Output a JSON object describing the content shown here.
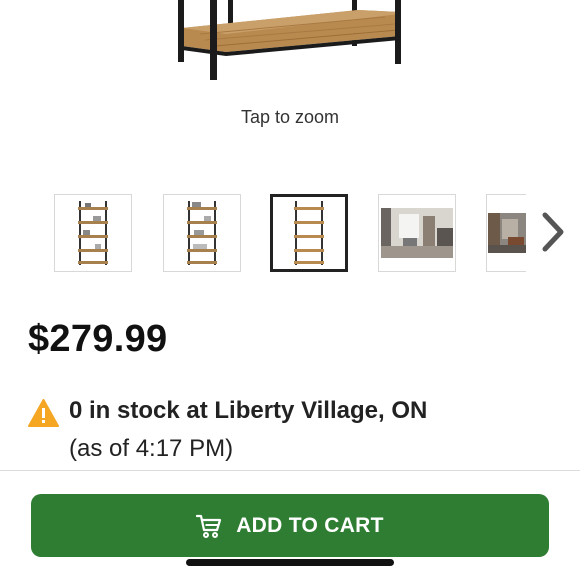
{
  "product": {
    "zoom_hint": "Tap to zoom",
    "price": "$279.99",
    "thumbnails": [
      {
        "icon": "shelf-thumbnail-1",
        "selected": false
      },
      {
        "icon": "shelf-thumbnail-2",
        "selected": false
      },
      {
        "icon": "shelf-thumbnail-3",
        "selected": true
      },
      {
        "icon": "room-scene-thumbnail-4",
        "selected": false
      },
      {
        "icon": "room-scene-thumbnail-5",
        "selected": false
      }
    ],
    "next_icon": "chevron-right-icon"
  },
  "stock": {
    "icon": "warning-icon",
    "line1": "0 in stock at Liberty Village, ON",
    "line2": "(as of 4:17 PM)"
  },
  "cart": {
    "label": "ADD TO CART",
    "icon": "cart-icon"
  },
  "colors": {
    "accent": "#2e7d32",
    "warning": "#f5a623"
  }
}
